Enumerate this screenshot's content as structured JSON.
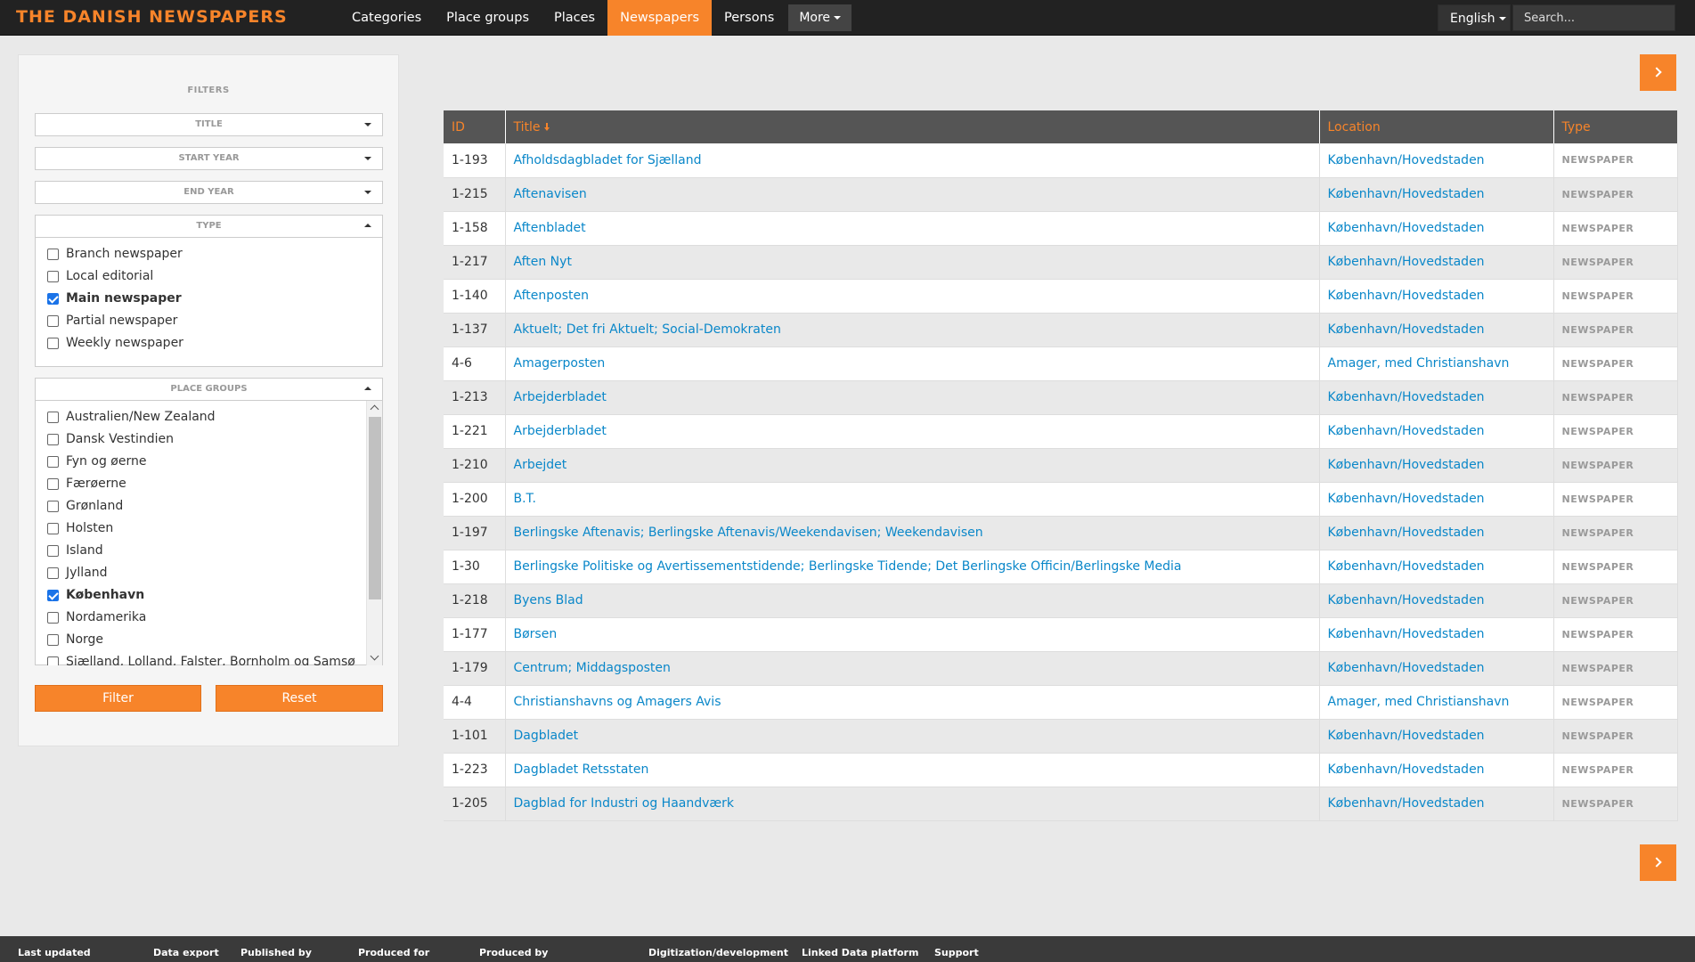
{
  "header": {
    "brand": "THE DANISH NEWSPAPERS",
    "nav": [
      {
        "label": "Categories",
        "active": false
      },
      {
        "label": "Place groups",
        "active": false
      },
      {
        "label": "Places",
        "active": false
      },
      {
        "label": "Newspapers",
        "active": true
      },
      {
        "label": "Persons",
        "active": false
      }
    ],
    "more_label": "More",
    "language": "English",
    "search_placeholder": "Search..."
  },
  "filters": {
    "title": "FILTERS",
    "title_filter": "TITLE",
    "start_year": "START YEAR",
    "end_year": "END YEAR",
    "type": {
      "label": "TYPE",
      "options": [
        {
          "label": "Branch newspaper",
          "checked": false
        },
        {
          "label": "Local editorial",
          "checked": false
        },
        {
          "label": "Main newspaper",
          "checked": true
        },
        {
          "label": "Partial newspaper",
          "checked": false
        },
        {
          "label": "Weekly newspaper",
          "checked": false
        }
      ]
    },
    "place_groups": {
      "label": "PLACE GROUPS",
      "options": [
        {
          "label": "Australien/New Zealand",
          "checked": false
        },
        {
          "label": "Dansk Vestindien",
          "checked": false
        },
        {
          "label": "Fyn og øerne",
          "checked": false
        },
        {
          "label": "Færøerne",
          "checked": false
        },
        {
          "label": "Grønland",
          "checked": false
        },
        {
          "label": "Holsten",
          "checked": false
        },
        {
          "label": "Island",
          "checked": false
        },
        {
          "label": "Jylland",
          "checked": false
        },
        {
          "label": "København",
          "checked": true
        },
        {
          "label": "Nordamerika",
          "checked": false
        },
        {
          "label": "Norge",
          "checked": false
        },
        {
          "label": "Sjælland, Lolland, Falster, Bornholm og Samsø",
          "checked": false
        }
      ]
    },
    "filter_button": "Filter",
    "reset_button": "Reset"
  },
  "table": {
    "columns": [
      "ID",
      "Title",
      "Location",
      "Type"
    ],
    "rows": [
      {
        "id": "1-193",
        "title": "Afholdsdagbladet for Sjælland",
        "location": "København/Hovedstaden",
        "type": "NEWSPAPER"
      },
      {
        "id": "1-215",
        "title": "Aftenavisen",
        "location": "København/Hovedstaden",
        "type": "NEWSPAPER"
      },
      {
        "id": "1-158",
        "title": "Aftenbladet",
        "location": "København/Hovedstaden",
        "type": "NEWSPAPER"
      },
      {
        "id": "1-217",
        "title": "Aften Nyt",
        "location": "København/Hovedstaden",
        "type": "NEWSPAPER"
      },
      {
        "id": "1-140",
        "title": "Aftenposten",
        "location": "København/Hovedstaden",
        "type": "NEWSPAPER"
      },
      {
        "id": "1-137",
        "title": "Aktuelt; Det fri Aktuelt; Social-Demokraten",
        "location": "København/Hovedstaden",
        "type": "NEWSPAPER"
      },
      {
        "id": "4-6",
        "title": "Amagerposten",
        "location": "Amager, med Christianshavn",
        "type": "NEWSPAPER"
      },
      {
        "id": "1-213",
        "title": "Arbejderbladet",
        "location": "København/Hovedstaden",
        "type": "NEWSPAPER"
      },
      {
        "id": "1-221",
        "title": "Arbejderbladet",
        "location": "København/Hovedstaden",
        "type": "NEWSPAPER"
      },
      {
        "id": "1-210",
        "title": "Arbejdet",
        "location": "København/Hovedstaden",
        "type": "NEWSPAPER"
      },
      {
        "id": "1-200",
        "title": "B.T.",
        "location": "København/Hovedstaden",
        "type": "NEWSPAPER"
      },
      {
        "id": "1-197",
        "title": "Berlingske Aftenavis; Berlingske Aftenavis/Weekendavisen; Weekendavisen",
        "location": "København/Hovedstaden",
        "type": "NEWSPAPER"
      },
      {
        "id": "1-30",
        "title": "Berlingske Politiske og Avertissementstidende; Berlingske Tidende; Det Berlingske Officin/Berlingske Media",
        "location": "København/Hovedstaden",
        "type": "NEWSPAPER"
      },
      {
        "id": "1-218",
        "title": "Byens Blad",
        "location": "København/Hovedstaden",
        "type": "NEWSPAPER"
      },
      {
        "id": "1-177",
        "title": "Børsen",
        "location": "København/Hovedstaden",
        "type": "NEWSPAPER"
      },
      {
        "id": "1-179",
        "title": "Centrum; Middagsposten",
        "location": "København/Hovedstaden",
        "type": "NEWSPAPER"
      },
      {
        "id": "4-4",
        "title": "Christianshavns og Amagers Avis",
        "location": "Amager, med Christianshavn",
        "type": "NEWSPAPER"
      },
      {
        "id": "1-101",
        "title": "Dagbladet",
        "location": "København/Hovedstaden",
        "type": "NEWSPAPER"
      },
      {
        "id": "1-223",
        "title": "Dagbladet Retsstaten",
        "location": "København/Hovedstaden",
        "type": "NEWSPAPER"
      },
      {
        "id": "1-205",
        "title": "Dagblad for Industri og Haandværk",
        "location": "København/Hovedstaden",
        "type": "NEWSPAPER"
      }
    ]
  },
  "footer": {
    "columns": [
      "Last updated",
      "Data export",
      "Published by",
      "Produced for",
      "Produced by",
      "Digitization/development",
      "Linked Data platform",
      "Support"
    ]
  },
  "colors": {
    "accent": "#f7842a",
    "link": "#0a87c9",
    "topbar": "#222222"
  }
}
